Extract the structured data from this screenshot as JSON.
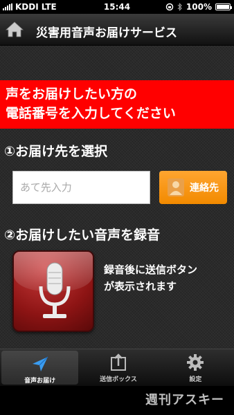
{
  "status_bar": {
    "carrier": "KDDI",
    "network": "LTE",
    "time": "15:44",
    "battery": "100%"
  },
  "header": {
    "title": "災害用音声お届けサービス",
    "home_icon": "home-icon"
  },
  "banner": {
    "line1": "声をお届けしたい方の",
    "line2": "電話番号を入力してください",
    "color": "#ff0000"
  },
  "step1": {
    "title": "①お届け先を選択",
    "input_placeholder": "あて先入力",
    "input_value": "",
    "contacts_button": "連絡先",
    "contacts_color": "#f7941d"
  },
  "step2": {
    "title": "②お届けしたい音声を録音",
    "record_icon": "microphone-icon",
    "hint_line1": "録音後に送信ボタン",
    "hint_line2": "が表示されます"
  },
  "tabs": [
    {
      "label": "音声お届け",
      "icon": "paper-plane-icon",
      "active": true
    },
    {
      "label": "送信ボックス",
      "icon": "outbox-icon",
      "active": false
    },
    {
      "label": "設定",
      "icon": "gear-icon",
      "active": false
    }
  ],
  "watermark": "週刊アスキー"
}
